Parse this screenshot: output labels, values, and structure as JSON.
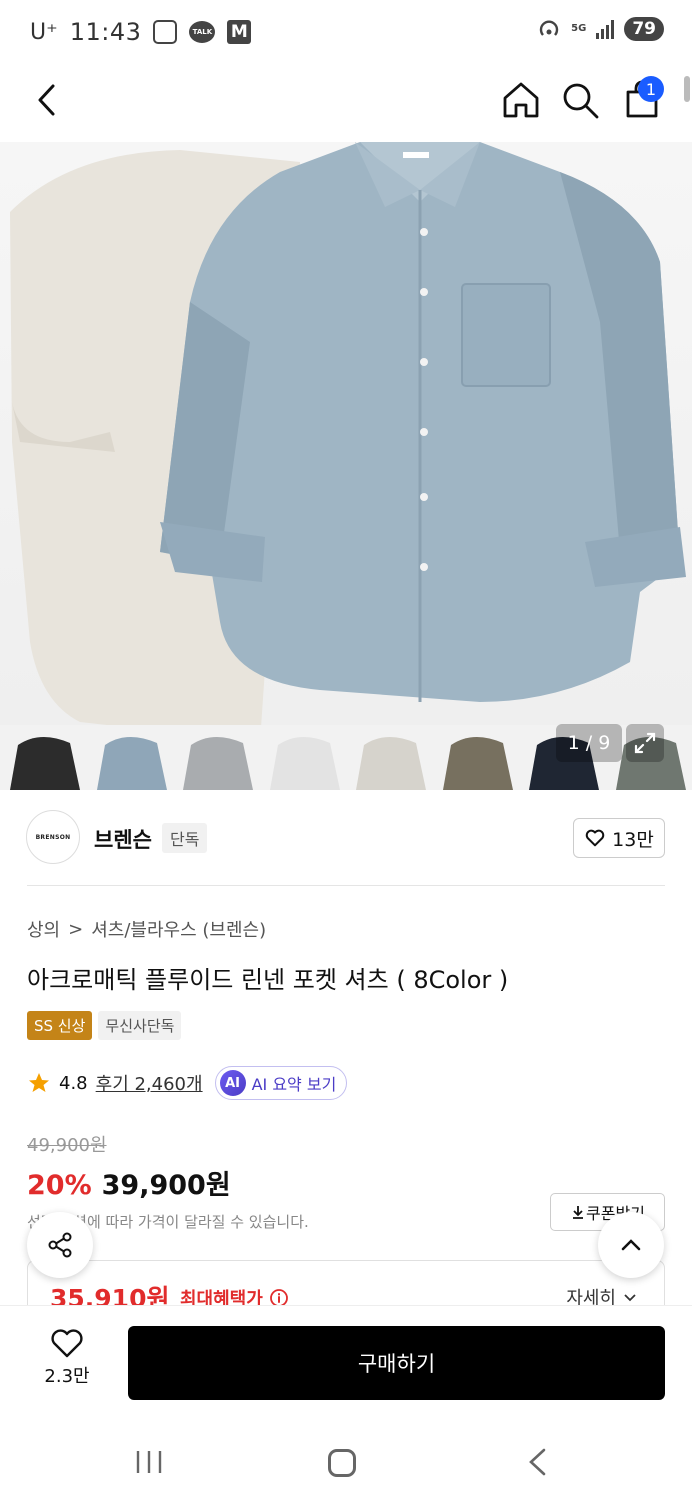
{
  "status_bar": {
    "carrier": "U⁺",
    "time": "11:43",
    "talk": "TALK",
    "m": "M",
    "network": "5G",
    "battery": "79"
  },
  "top_nav": {
    "cart_count": "1"
  },
  "gallery": {
    "page": "1 / 9",
    "thumb_colors": [
      "#2c2c2c",
      "#8fa6b8",
      "#a9acaf",
      "#e3e3e3",
      "#d6d3cc",
      "#77705f",
      "#1f2633",
      "#6f7770"
    ]
  },
  "brand": {
    "logo_text": "BRENSON",
    "name": "브렌슨",
    "tag": "단독",
    "likes": "13만"
  },
  "breadcrumb": {
    "category": "상의",
    "separator": ">",
    "subcategory": "셔츠/블라우스 (브렌슨)"
  },
  "product": {
    "title": "아크로매틱 플루이드 린넨 포켓 셔츠 ( 8Color )",
    "badge_new": "SS 신상",
    "badge_exclusive": "무신사단독",
    "rating": "4.8",
    "reviews": "후기 2,460개",
    "ai_icon": "AI",
    "ai_summary": "AI 요약 보기",
    "original_price": "49,900원",
    "discount": "20%",
    "sale_price": "39,900원",
    "price_note": "선택 옵션에 따라 가격이 달라질 수 있습니다.",
    "coupon": "쿠폰받기",
    "max_benefit_price": "35,910원",
    "max_benefit_label": "최대혜택가",
    "detail": "자세히"
  },
  "bottom_bar": {
    "wish_count": "2.3만",
    "buy": "구매하기"
  },
  "colors": {
    "accent_red": "#e12c2c",
    "badge_blue": "#1a5cff",
    "ss_badge": "#c48418",
    "ai_purple": "#4b3cc6"
  }
}
